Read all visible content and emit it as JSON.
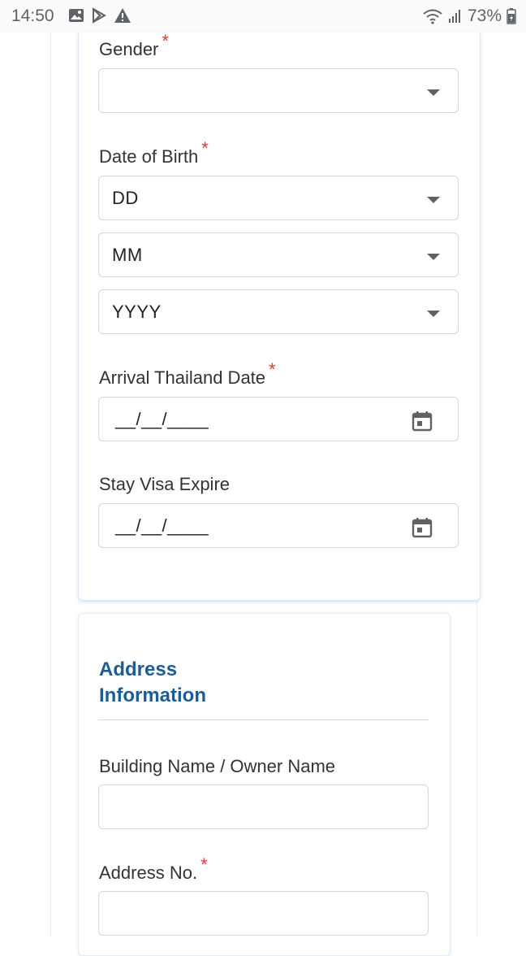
{
  "status_bar": {
    "time": "14:50",
    "battery": "73%",
    "icons": [
      "gallery-icon",
      "play-store-icon",
      "warning-icon",
      "wifi-icon",
      "signal-icon",
      "battery-icon"
    ]
  },
  "form": {
    "gender": {
      "label": "Gender",
      "required": "*",
      "value": ""
    },
    "dob": {
      "label": "Date of Birth",
      "required": "*",
      "day": "DD",
      "month": "MM",
      "year": "YYYY"
    },
    "arrival": {
      "label": "Arrival Thailand Date",
      "required": "*",
      "value": "__/__/____"
    },
    "visa_expire": {
      "label": "Stay Visa Expire",
      "value": "__/__/____"
    }
  },
  "address": {
    "title_line1": "Address",
    "title_line2": "Information",
    "building": {
      "label": "Building Name / Owner Name",
      "value": ""
    },
    "address_no": {
      "label": "Address No.",
      "required": "*",
      "value": ""
    }
  },
  "colors": {
    "accent": "#1c5d96",
    "required": "#e53935",
    "border": "#d6d6d6"
  }
}
